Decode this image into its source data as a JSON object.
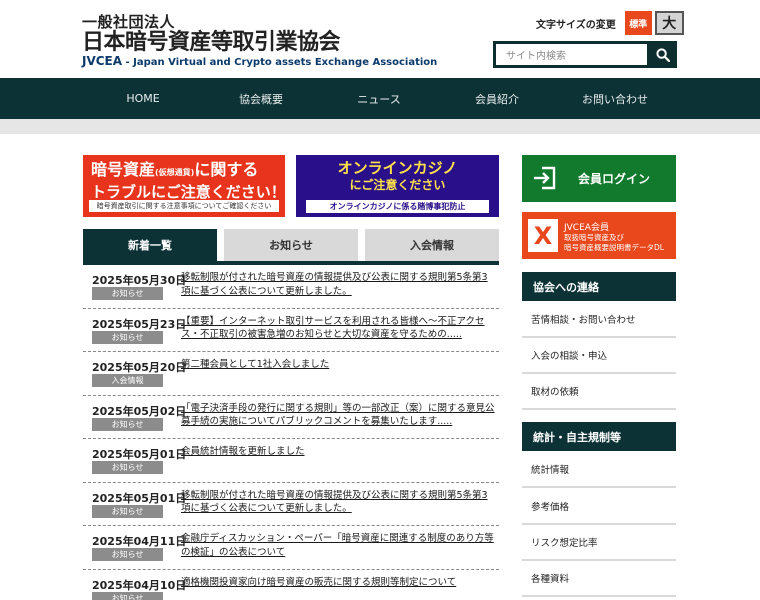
{
  "header": {
    "logo_line1": "一般社団法人",
    "logo_line2": "日本暗号資産等取引業協会",
    "logo_abbr": "JVCEA",
    "logo_english": " - Japan Virtual and Crypto assets Exchange Association",
    "font_size_label": "文字サイズの変更",
    "font_size_standard": "標準",
    "font_size_large": "大",
    "search_placeholder": "サイト内検索",
    "search_icon": "search-icon"
  },
  "nav": {
    "items": [
      "HOME",
      "協会概要",
      "ニュース",
      "会員紹介",
      "お問い合わせ"
    ]
  },
  "banners": {
    "crypto_title_a": "暗号資産",
    "crypto_title_small": "(仮想通貨)",
    "crypto_title_b": "に関する",
    "crypto_title_line2": "トラブルにご注意ください！",
    "crypto_sub": "暗号資産取引に関する注意事項についてご確認ください",
    "casino_title": "オンラインカジノ",
    "casino_sub": "にご注意ください",
    "casino_bar": "オンラインカジノに係る賭博事犯防止"
  },
  "tabs": {
    "items": [
      "新着一覧",
      "お知らせ",
      "入会情報"
    ]
  },
  "news": [
    {
      "date": "2025年05月30日",
      "category": "お知らせ",
      "title": "移転制限が付された暗号資産の情報提供及び公表に関する規則第5条第3項に基づく公表について更新しました。"
    },
    {
      "date": "2025年05月23日",
      "category": "お知らせ",
      "title": "【重要】インターネット取引サービスを利用される皆様へ～不正アクセス・不正取引の被害急増のお知らせと大切な資産を守るための....."
    },
    {
      "date": "2025年05月20日",
      "category": "入会情報",
      "title": "第二種会員として1社入会しました"
    },
    {
      "date": "2025年05月02日",
      "category": "お知らせ",
      "title": "「電子決済手段の発行に関する規則」等の一部改正（案）に関する意見公募手続の実施についてパブリックコメントを募集いたします....."
    },
    {
      "date": "2025年05月01日",
      "category": "お知らせ",
      "title": "会員統計情報を更新しました"
    },
    {
      "date": "2025年05月01日",
      "category": "お知らせ",
      "title": "移転制限が付された暗号資産の情報提供及び公表に関する規則第5条第3項に基づく公表について更新しました。"
    },
    {
      "date": "2025年04月11日",
      "category": "お知らせ",
      "title": "金融庁ディスカッション・ペーパー「暗号資産に関連する制度のあり方等の検証」の公表について"
    },
    {
      "date": "2025年04月10日",
      "category": "お知らせ",
      "title": "適格機関投資家向け暗号資産の販売に関する規則等制定について"
    }
  ],
  "sidebar": {
    "login_label": "会員ログイン",
    "jvcea_title": "JVCEA会員",
    "jvcea_line1": "取扱暗号資産及び",
    "jvcea_line2": "暗号資産概要説明書データDL",
    "contact_heading": "協会への連絡",
    "contact_items": [
      "苦情相談・お問い合わせ",
      "入会の相談・申込",
      "取材の依頼"
    ],
    "stats_heading": "統計・自主規制等",
    "stats_items": [
      "統計情報",
      "参考価格",
      "リスク想定比率",
      "各種資料"
    ]
  },
  "colors": {
    "nav_bg": "#0d3236",
    "accent_red": "#e8481c",
    "login_green": "#117a2d",
    "casino_purple": "#2a0f8a"
  }
}
